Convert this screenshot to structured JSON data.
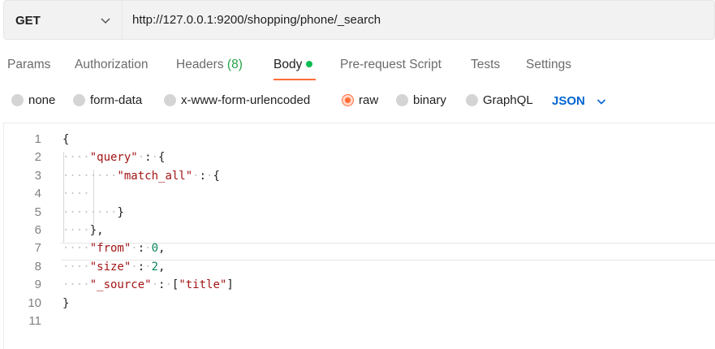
{
  "request": {
    "method": "GET",
    "url": "http://127.0.0.1:9200/shopping/phone/_search"
  },
  "tabs": [
    {
      "label": "Params"
    },
    {
      "label": "Authorization"
    },
    {
      "label": "Headers",
      "count": "(8)"
    },
    {
      "label": "Body"
    },
    {
      "label": "Pre-request Script"
    },
    {
      "label": "Tests"
    },
    {
      "label": "Settings"
    }
  ],
  "active_tab": "Body",
  "body_types": [
    "none",
    "form-data",
    "x-www-form-urlencoded",
    "raw",
    "binary",
    "GraphQL"
  ],
  "selected_body_type": "raw",
  "language": "JSON",
  "editor": {
    "line_numbers": [
      "1",
      "2",
      "3",
      "4",
      "5",
      "6",
      "7",
      "8",
      "9",
      "10",
      "11"
    ],
    "lines": [
      "{",
      "    \"query\" : {",
      "        \"match_all\" : {",
      "    ",
      "        }",
      "    },",
      "    \"from\" : 0,",
      "    \"size\" : 2,",
      "    \"_source\" : [\"title\"]",
      "}",
      ""
    ]
  },
  "colors": {
    "accent_orange": "#ff6c37",
    "json_blue": "#0265d2",
    "body_dot_green": "#0cbb52",
    "headers_count_green": "#26a147"
  }
}
